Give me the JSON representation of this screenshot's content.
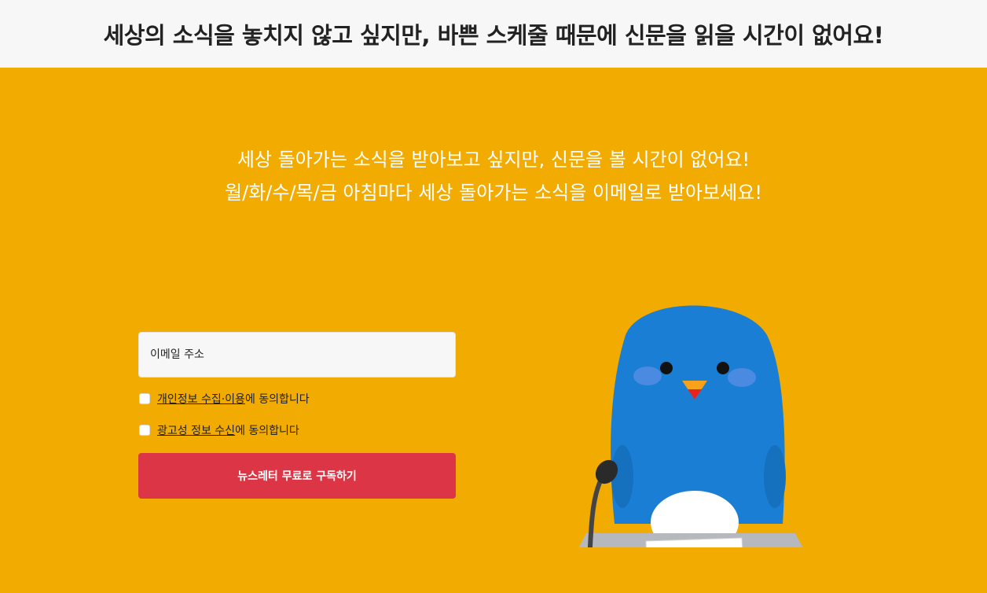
{
  "header": {
    "title": "세상의 소식을 놓치지 않고 싶지만, 바쁜 스케줄 때문에 신문을 읽을 시간이 없어요!"
  },
  "hero": {
    "line1": "세상 돌아가는 소식을 받아보고 싶지만, 신문을 볼 시간이 없어요!",
    "line2": "월/화/수/목/금 아침마다 세상 돌아가는 소식을 이메일로 받아보세요!"
  },
  "form": {
    "email_placeholder": "이메일 주소",
    "consent_privacy": {
      "link": "개인정보 수집·이용",
      "suffix": "에 동의합니다",
      "checked": false
    },
    "consent_marketing": {
      "link": "광고성 정보 수신",
      "suffix": "에 동의합니다",
      "checked": false
    },
    "submit_label": "뉴스레터 무료로 구독하기"
  },
  "colors": {
    "background": "#f2ab00",
    "header_bg": "#f7f7f7",
    "button": "#dc3545",
    "penguin": "#1a7fd4"
  },
  "illustration": {
    "icon": "penguin-news-anchor-icon"
  }
}
